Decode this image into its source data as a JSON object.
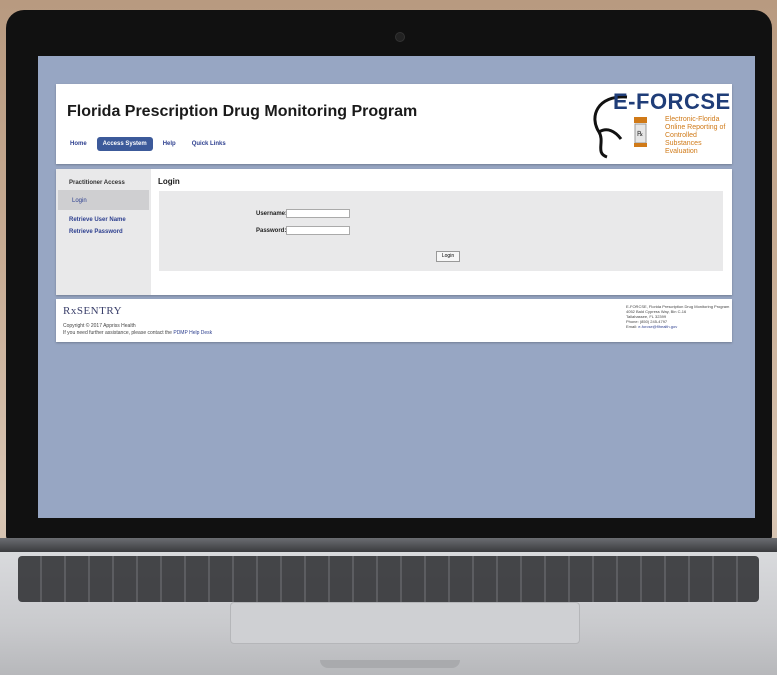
{
  "site": {
    "title": "Florida Prescription Drug Monitoring Program"
  },
  "nav": {
    "items": [
      "Home",
      "Access System",
      "Help",
      "Quick Links"
    ],
    "active": "Access System"
  },
  "logo": {
    "title": "E-FORCSE",
    "subtitle_lines": [
      "Electronic-Florida",
      "Online Reporting of",
      "Controlled Substances",
      "Evaluation"
    ]
  },
  "sidebar": {
    "heading": "Practitioner Access",
    "items": [
      "Login",
      "Retrieve User Name",
      "Retrieve Password"
    ]
  },
  "login": {
    "title": "Login",
    "username_label": "Username:",
    "password_label": "Password:",
    "username_value": "",
    "password_value": "",
    "button_label": "Login"
  },
  "footer": {
    "brand": "RxSENTRY",
    "copyright": "Copyright © 2017 Appriss Health",
    "assist_prefix": "If you need further assistance, please contact the ",
    "assist_link": "PDMP Help Desk",
    "address_lines": [
      "E-FORCSE, Florida Prescription Drug Monitoring Program",
      "4052 Bald Cypress Way, Bin C-16",
      "Tallahassee, FL 32399",
      "Phone: (850) 245-4797"
    ],
    "email_prefix": "Email: ",
    "email": "e-forcse@flhealth.gov"
  },
  "colors": {
    "screen_bg": "#97a6c3",
    "nav_active": "#3c5a9a",
    "link": "#2d3f8f",
    "logo_blue": "#1f3d78",
    "logo_orange": "#d07a18"
  }
}
